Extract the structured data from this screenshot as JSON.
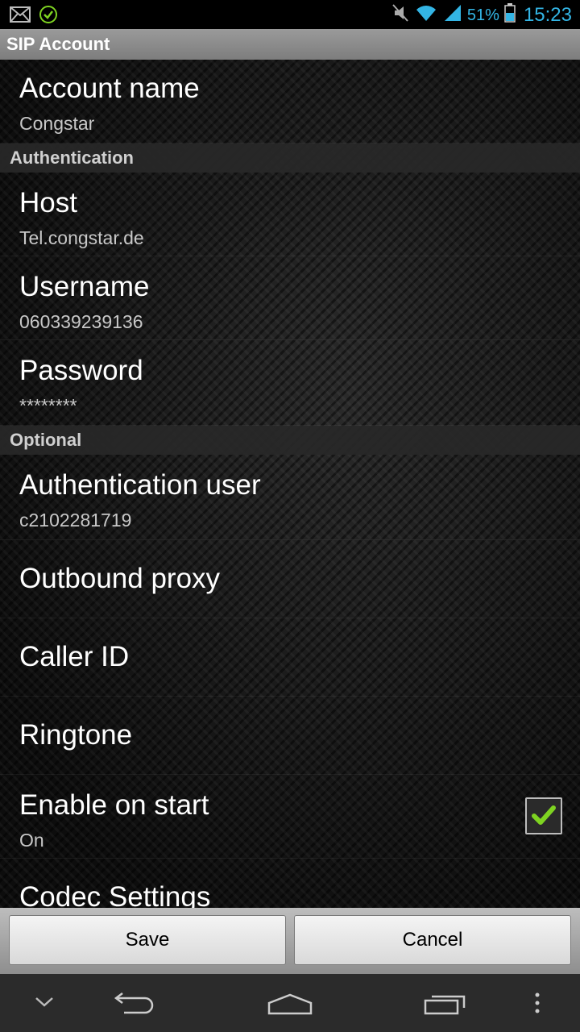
{
  "status_bar": {
    "battery_percent": "51%",
    "time": "15:23",
    "icons": [
      "mail-icon",
      "check-circle-icon",
      "mute-icon",
      "wifi-icon",
      "signal-icon",
      "battery-icon"
    ]
  },
  "title": "SIP Account",
  "preferences": {
    "account_name": {
      "title": "Account name",
      "summary": "Congstar"
    },
    "auth_header": "Authentication",
    "host": {
      "title": "Host",
      "summary": "Tel.congstar.de"
    },
    "username": {
      "title": "Username",
      "summary": "060339239136"
    },
    "password": {
      "title": "Password",
      "summary": "********"
    },
    "optional_header": "Optional",
    "auth_user": {
      "title": "Authentication user",
      "summary": "c2102281719"
    },
    "outbound_proxy": {
      "title": "Outbound proxy"
    },
    "caller_id": {
      "title": "Caller ID"
    },
    "ringtone": {
      "title": "Ringtone"
    },
    "enable_on_start": {
      "title": "Enable on start",
      "summary": "On",
      "checked": true
    },
    "codec_settings": {
      "title": "Codec Settings"
    }
  },
  "buttons": {
    "save": "Save",
    "cancel": "Cancel"
  },
  "nav": {
    "icons": [
      "keyboard-hide-icon",
      "back-icon",
      "home-icon",
      "recent-apps-icon",
      "overflow-menu-icon"
    ]
  },
  "colors": {
    "accent": "#33b5e5",
    "check": "#7ed321"
  }
}
